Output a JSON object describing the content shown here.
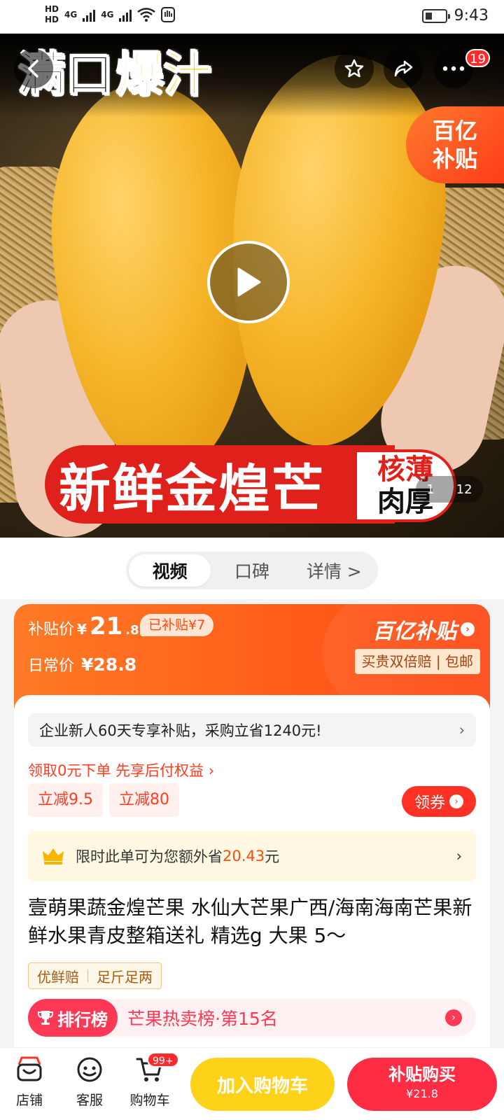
{
  "status_bar": {
    "time": "9:43",
    "hd1": "HD",
    "hd2": "HD",
    "net1": "4G",
    "net2": "4G"
  },
  "hero": {
    "slogan_part1": "满口",
    "slogan_part2": "爆汁",
    "cart_count": "19",
    "subsidy_badge_line1": "百亿",
    "subsidy_badge_line2": "补贴",
    "banner_main": "新鲜金煌芒",
    "banner_side_line1": "核薄",
    "banner_side_line2": "肉厚",
    "pager_current": "1",
    "pager_total": "12"
  },
  "tabs": [
    {
      "label": "视频",
      "active": true
    },
    {
      "label": "口碑",
      "active": false
    },
    {
      "label": "详情 >",
      "active": false
    }
  ],
  "price": {
    "subsidy_label": "补贴价",
    "subsidy_currency": "¥",
    "subsidy_int": "21",
    "subsidy_dec": ".8",
    "subsidized_tag": "已补贴¥7",
    "daily_label": "日常价",
    "daily_price": "¥28.8",
    "brand": "百亿补贴",
    "guarantee": "买贵双倍赔 | 包邮"
  },
  "promo": {
    "enterprise_text": "企业新人60天专享补贴，采购立省1240元!",
    "pay_later_link": "领取0元下单 先享后付权益 ›",
    "coupon1": "立减9.5",
    "coupon2": "立减80",
    "get_coupon": "领券",
    "save_prefix": "限时此单可为您额外省",
    "save_amount": "20.43",
    "save_suffix": "元"
  },
  "product": {
    "title": "壹萌果蔬金煌芒果 水仙大芒果广西/海南海南芒果新鲜水果青皮整箱送礼 精选g 大果 5～",
    "tag1": "优鲜赔",
    "tag2": "足斤足两",
    "rank_badge": "排行榜",
    "rank_text": "芒果热卖榜·第15名"
  },
  "bottom_bar": {
    "store": "店铺",
    "service": "客服",
    "cart": "购物车",
    "cart_badge": "99+",
    "add_to_cart": "加入购物车",
    "buy_label": "补贴购买",
    "buy_price": "¥21.8"
  },
  "colors": {
    "accent_red": "#ff3125",
    "subsidy_orange": "#ff5e1a",
    "cart_yellow": "#ffd21a"
  }
}
